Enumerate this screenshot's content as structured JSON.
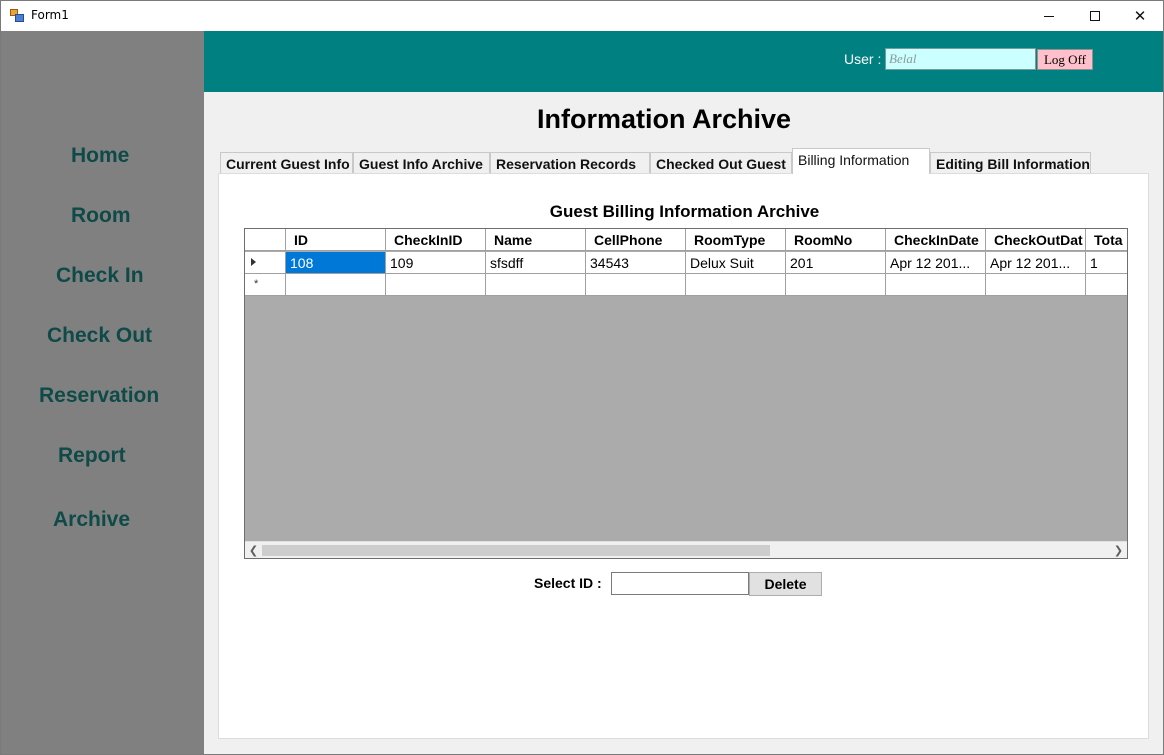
{
  "window": {
    "title": "Form1",
    "controls": {
      "minimize_icon": "minimize-icon",
      "maximize_icon": "maximize-icon",
      "close_glyph": "✕"
    }
  },
  "sidebar": {
    "items": [
      {
        "label": "Home"
      },
      {
        "label": "Room"
      },
      {
        "label": "Check In"
      },
      {
        "label": "Check Out"
      },
      {
        "label": "Reservation"
      },
      {
        "label": "Report"
      },
      {
        "label": "Archive"
      }
    ]
  },
  "header": {
    "user_label": "User :",
    "user_value": "Belal",
    "logoff_label": "Log Off"
  },
  "main": {
    "title": "Information Archive",
    "tabs": [
      {
        "label": "Current Guest Info"
      },
      {
        "label": "Guest Info Archive"
      },
      {
        "label": "Reservation Records"
      },
      {
        "label": "Checked Out Guest"
      },
      {
        "label": "Billing Information",
        "active": true
      },
      {
        "label": "Editing Bill Information"
      }
    ],
    "section_title": "Guest Billing Information Archive",
    "grid": {
      "columns": [
        "ID",
        "CheckInID",
        "Name",
        "CellPhone",
        "RoomType",
        "RoomNo",
        "CheckInDate",
        "CheckOutDat",
        "Tota"
      ],
      "rows": [
        [
          "108",
          "109",
          "sfsdff",
          "34543",
          "Delux Suit",
          "201",
          "Apr 12 201...",
          "Apr 12 201...",
          "1"
        ]
      ],
      "new_row_marker": "*"
    },
    "select_id_label": "Select ID :",
    "select_id_value": "",
    "delete_label": "Delete"
  },
  "colors": {
    "header_teal": "#008080",
    "sidebar_gray": "#808080",
    "nav_text": "#0e4a48",
    "user_input_bg": "#ccffff",
    "logoff_bg": "#ffc0cb",
    "selection_blue": "#0078d7"
  }
}
